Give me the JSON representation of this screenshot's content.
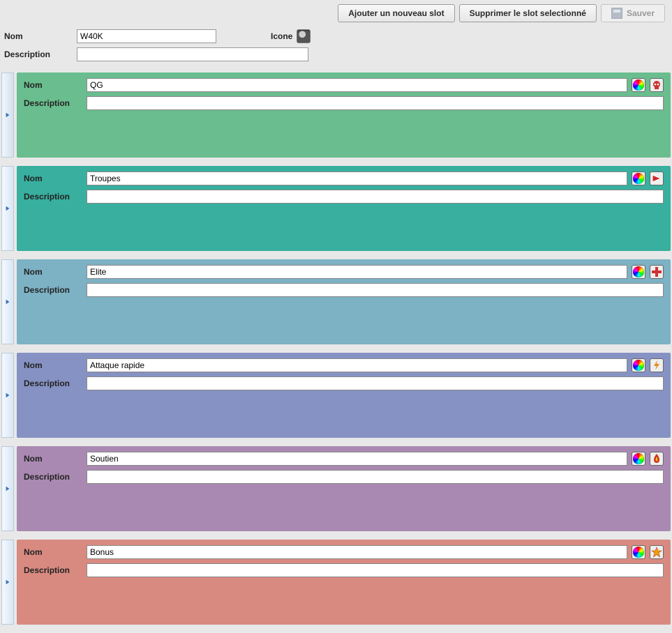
{
  "toolbar": {
    "add_label": "Ajouter un nouveau slot",
    "delete_label": "Supprimer le slot selectionné",
    "save_label": "Sauver"
  },
  "header": {
    "name_label": "Nom",
    "name_value": "W40K",
    "icon_label": "Icone",
    "description_label": "Description",
    "description_value": ""
  },
  "slot_labels": {
    "name": "Nom",
    "description": "Description"
  },
  "slots": [
    {
      "name": "QG",
      "description": "",
      "color": "c-green",
      "icon": "skull"
    },
    {
      "name": "Troupes",
      "description": "",
      "color": "c-teal",
      "icon": "triangle"
    },
    {
      "name": "Elite",
      "description": "",
      "color": "c-blue",
      "icon": "cross"
    },
    {
      "name": "Attaque rapide",
      "description": "",
      "color": "c-violet",
      "icon": "bolt"
    },
    {
      "name": "Soutien",
      "description": "",
      "color": "c-purple",
      "icon": "flame"
    },
    {
      "name": "Bonus",
      "description": "",
      "color": "c-red",
      "icon": "star"
    }
  ]
}
